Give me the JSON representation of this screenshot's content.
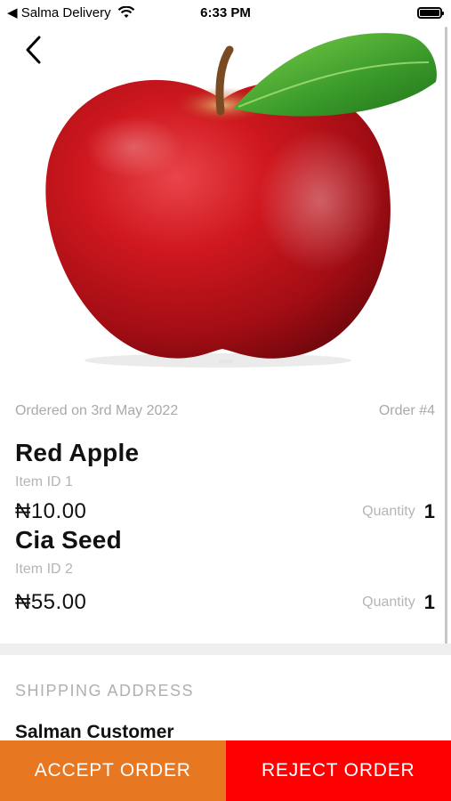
{
  "status_bar": {
    "back_app": "◀ Salma Delivery",
    "time": "6:33 PM",
    "battery_level": 1.0
  },
  "product_image": {
    "subject": "red apple with leaf",
    "colors": {
      "apple": "#c8141c",
      "leaf": "#3fa32d",
      "stem": "#7a4a22"
    }
  },
  "order": {
    "ordered_on": "Ordered on 3rd May 2022",
    "order_number": "Order #4",
    "items": [
      {
        "name": "Red Apple",
        "item_id": "Item ID 1",
        "price": "₦10.00",
        "quantity_label": "Quantity",
        "quantity": "1"
      },
      {
        "name": "Cia Seed",
        "item_id": "Item ID 2",
        "price": "₦55.00",
        "quantity_label": "Quantity",
        "quantity": "1"
      }
    ]
  },
  "shipping": {
    "heading": "SHIPPING ADDRESS",
    "customer_name": "Salman Customer"
  },
  "actions": {
    "accept_label": "ACCEPT ORDER",
    "reject_label": "REJECT ORDER",
    "accept_color": "#e87722",
    "reject_color": "#ff0000"
  }
}
